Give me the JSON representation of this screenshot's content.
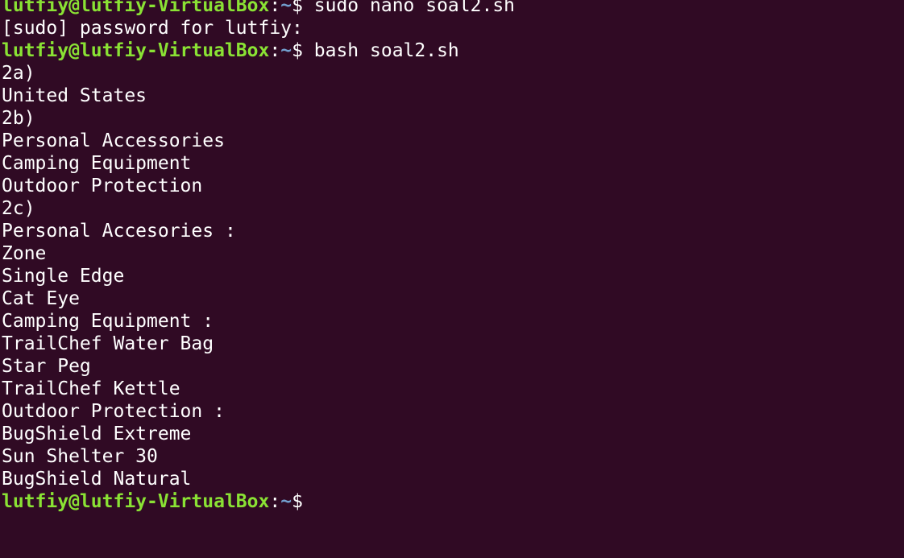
{
  "terminal": {
    "user_host": "lutfiy@lutfiy-VirtualBox",
    "separator": ":",
    "path": "~",
    "dollar": "$",
    "lines": [
      {
        "type": "prompt",
        "cmd": " sudo nano soal2.sh"
      },
      {
        "type": "out",
        "text": "[sudo] password for lutfiy:"
      },
      {
        "type": "prompt",
        "cmd": " bash soal2.sh"
      },
      {
        "type": "out",
        "text": "2a)"
      },
      {
        "type": "out",
        "text": "United States"
      },
      {
        "type": "out",
        "text": "2b)"
      },
      {
        "type": "out",
        "text": "Personal Accessories"
      },
      {
        "type": "out",
        "text": "Camping Equipment"
      },
      {
        "type": "out",
        "text": "Outdoor Protection"
      },
      {
        "type": "out",
        "text": "2c)"
      },
      {
        "type": "out",
        "text": "Personal Accesories :"
      },
      {
        "type": "out",
        "text": "Zone"
      },
      {
        "type": "out",
        "text": "Single Edge"
      },
      {
        "type": "out",
        "text": "Cat Eye"
      },
      {
        "type": "out",
        "text": "Camping Equipment :"
      },
      {
        "type": "out",
        "text": "TrailChef Water Bag"
      },
      {
        "type": "out",
        "text": "Star Peg"
      },
      {
        "type": "out",
        "text": "TrailChef Kettle"
      },
      {
        "type": "out",
        "text": "Outdoor Protection :"
      },
      {
        "type": "out",
        "text": "BugShield Extreme"
      },
      {
        "type": "out",
        "text": "Sun Shelter 30"
      },
      {
        "type": "out",
        "text": "BugShield Natural"
      },
      {
        "type": "prompt",
        "cmd": ""
      }
    ]
  }
}
